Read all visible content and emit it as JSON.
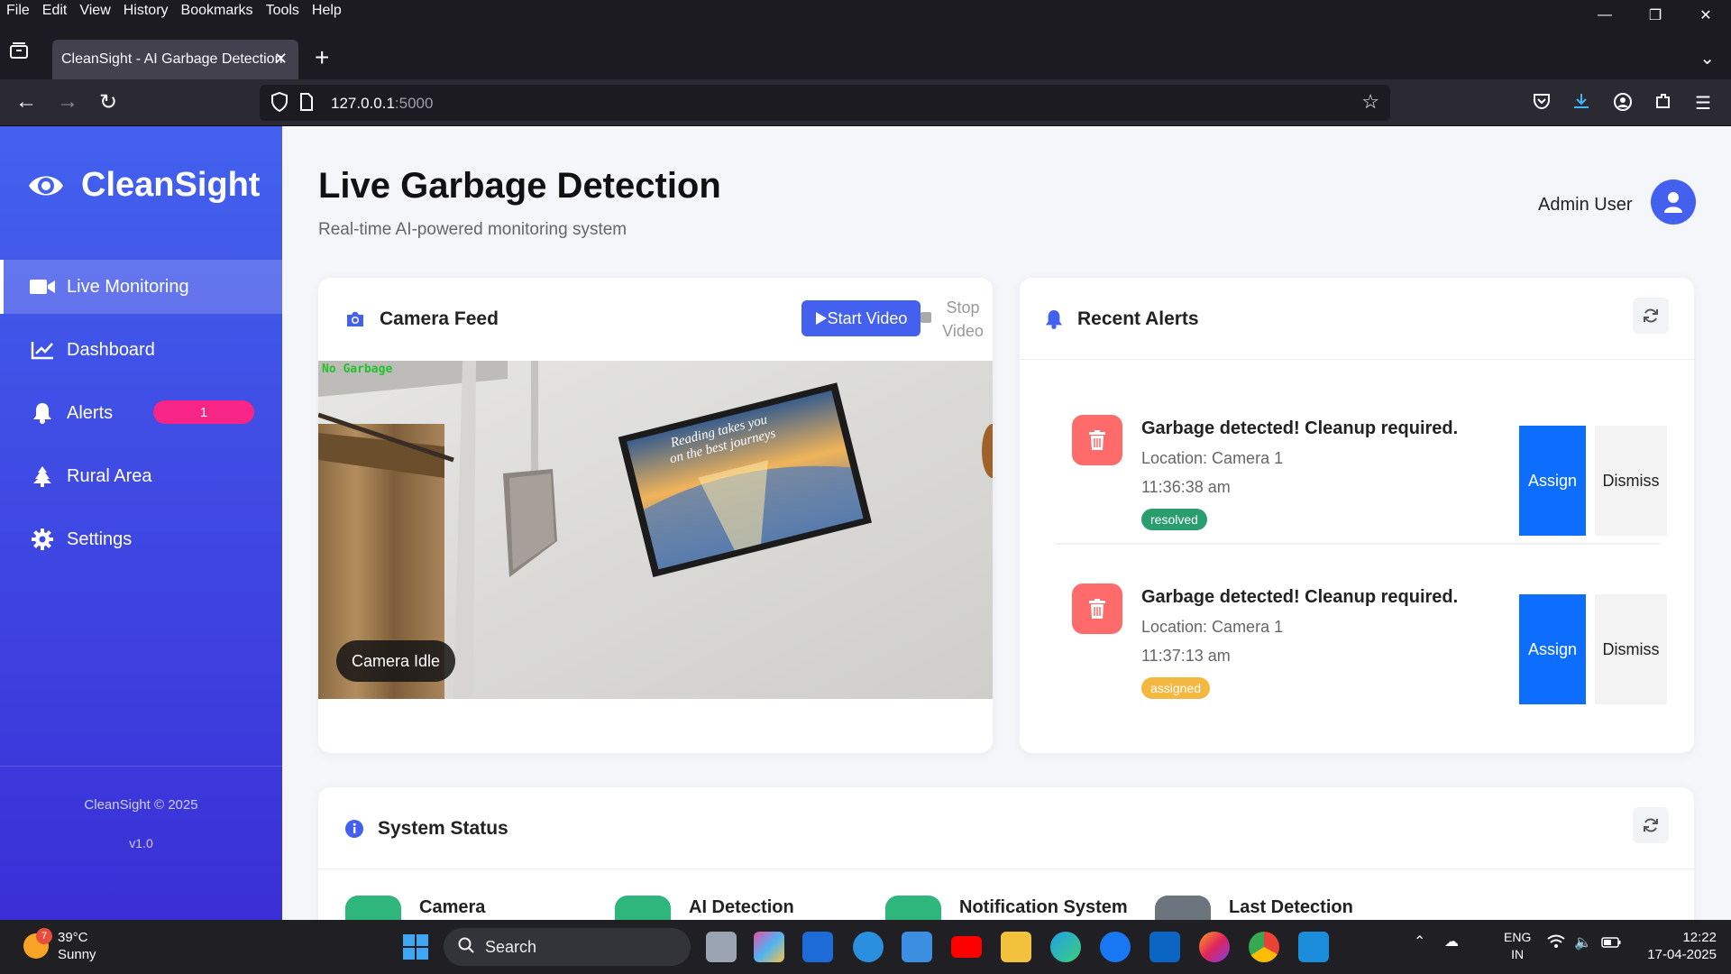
{
  "browser": {
    "menu": [
      "File",
      "Edit",
      "View",
      "History",
      "Bookmarks",
      "Tools",
      "Help"
    ],
    "tab_title": "CleanSight - AI Garbage Detection",
    "url_host": "127.0.0.1",
    "url_port": ":5000"
  },
  "sidebar": {
    "brand": "CleanSight",
    "items": [
      {
        "label": "Live Monitoring",
        "icon": "video-camera-icon",
        "active": true
      },
      {
        "label": "Dashboard",
        "icon": "chart-line-icon"
      },
      {
        "label": "Alerts",
        "icon": "bell-icon",
        "badge": "1"
      },
      {
        "label": "Rural Area",
        "icon": "tree-icon"
      },
      {
        "label": "Settings",
        "icon": "gear-icon"
      }
    ],
    "footer_copyright": "CleanSight © 2025",
    "footer_version": "v1.0"
  },
  "header": {
    "title": "Live Garbage Detection",
    "subtitle": "Real-time AI-powered monitoring system",
    "user": "Admin User"
  },
  "camera": {
    "title": "Camera Feed",
    "start_label": "Start Video",
    "stop_label_1": "Stop",
    "stop_label_2": "Video",
    "overlay_status": "No Garbage",
    "idle_label": "Camera Idle",
    "poster_line1": "Reading takes you",
    "poster_line2": "on the best journeys"
  },
  "alerts": {
    "title": "Recent Alerts",
    "items": [
      {
        "title": "Garbage detected! Cleanup required.",
        "location": "Location: Camera 1",
        "time": "11:36:38 am",
        "status": "resolved",
        "status_color": "#2a9d6f",
        "assign": "Assign",
        "dismiss": "Dismiss"
      },
      {
        "title": "Garbage detected! Cleanup required.",
        "location": "Location: Camera 1",
        "time": "11:37:13 am",
        "status": "assigned",
        "status_color": "#f4b740",
        "assign": "Assign",
        "dismiss": "Dismiss"
      }
    ]
  },
  "system_status": {
    "title": "System Status",
    "items": [
      {
        "label": "Camera",
        "color": "#2fb67c"
      },
      {
        "label": "AI Detection",
        "color": "#2fb67c"
      },
      {
        "label": "Notification System",
        "color": "#2fb67c"
      },
      {
        "label": "Last Detection",
        "color": "#6c757d"
      }
    ]
  },
  "taskbar": {
    "weather_temp": "39°C",
    "weather_desc": "Sunny",
    "weather_badge": "7",
    "search_placeholder": "Search",
    "lang_1": "ENG",
    "lang_2": "IN",
    "time": "12:22",
    "date": "17-04-2025"
  },
  "colors": {
    "accent": "#4361ee",
    "badge": "#f72585",
    "danger": "#ff6b6b",
    "assign": "#0d6efd"
  }
}
